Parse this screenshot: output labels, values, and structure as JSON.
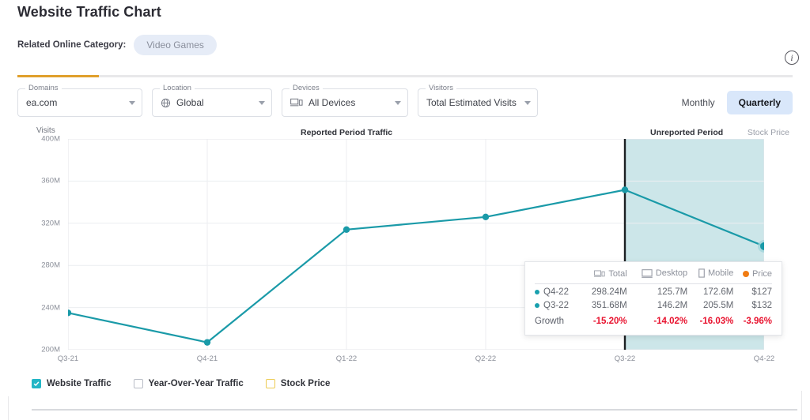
{
  "header": {
    "title": "Website Traffic Chart",
    "category_label": "Related Online Category:",
    "category_value": "Video Games",
    "info_icon": "info-icon",
    "info_glyph": "i"
  },
  "filters": [
    {
      "legend": "Domains",
      "value": "ea.com",
      "icon": "none"
    },
    {
      "legend": "Location",
      "value": "Global",
      "icon": "globe-icon"
    },
    {
      "legend": "Devices",
      "value": "All Devices",
      "icon": "devices-icon"
    },
    {
      "legend": "Visitors",
      "value": "Total Estimated Visits",
      "icon": "none"
    }
  ],
  "period_toggle": {
    "monthly": "Monthly",
    "quarterly": "Quarterly",
    "selected": "Quarterly"
  },
  "chart_labels": {
    "y_axis_title": "Visits",
    "reported": "Reported Period Traffic",
    "unreported": "Unreported Period",
    "stock_price": "Stock Price"
  },
  "tooltip": {
    "columns": [
      {
        "label": "Total",
        "icon": "devices-icon"
      },
      {
        "label": "Desktop",
        "icon": "monitor-icon"
      },
      {
        "label": "Mobile",
        "icon": "phone-icon"
      },
      {
        "label": "Price",
        "icon": "orange-dot-icon"
      }
    ],
    "rows": [
      {
        "period": "Q4-22",
        "total": "298.24M",
        "desktop": "125.7M",
        "mobile": "172.6M",
        "price": "$127"
      },
      {
        "period": "Q3-22",
        "total": "351.68M",
        "desktop": "146.2M",
        "mobile": "205.5M",
        "price": "$132"
      }
    ],
    "growth": {
      "label": "Growth",
      "total": "-15.20%",
      "desktop": "-14.02%",
      "mobile": "-16.03%",
      "price": "-3.96%"
    }
  },
  "legend": [
    {
      "label": "Website Traffic",
      "checked": true,
      "color": "#23b6c6"
    },
    {
      "label": "Year-Over-Year Traffic",
      "checked": false,
      "color": "#b9bdc6"
    },
    {
      "label": "Stock Price",
      "checked": false,
      "color": "#eccb52"
    }
  ],
  "colors": {
    "line": "#1a9aa8",
    "accent_orange": "#e0a02c",
    "price_orange": "#f07c13",
    "unreported_shade": "#cce6e9",
    "divider_line": "#1c2023",
    "negative": "#e8112d"
  },
  "chart_data": {
    "type": "line",
    "title": "Website Traffic Chart",
    "xlabel": "",
    "ylabel": "Visits",
    "categories": [
      "Q3-21",
      "Q4-21",
      "Q1-22",
      "Q2-22",
      "Q3-22",
      "Q4-22"
    ],
    "series": [
      {
        "name": "Website Traffic",
        "values": [
          235.0,
          207.0,
          314.0,
          326.0,
          351.68,
          298.24
        ],
        "unit": "M",
        "color": "#1a9aa8"
      }
    ],
    "ylim": [
      200,
      400
    ],
    "yticks": [
      200,
      240,
      280,
      320,
      360,
      400
    ],
    "ytick_labels": [
      "200M",
      "240M",
      "280M",
      "320M",
      "360M",
      "400M"
    ],
    "grid": true,
    "legend_position": "bottom-left",
    "annotations": [
      {
        "text": "Reported Period Traffic",
        "position": "top-left"
      },
      {
        "text": "Unreported Period",
        "position": "top-right",
        "span": [
          "Q3-22",
          "Q4-22"
        ]
      },
      {
        "text": "Stock Price",
        "position": "top-far-right"
      }
    ],
    "highlighted_point": "Q4-22",
    "divider_at": "Q3-22"
  }
}
